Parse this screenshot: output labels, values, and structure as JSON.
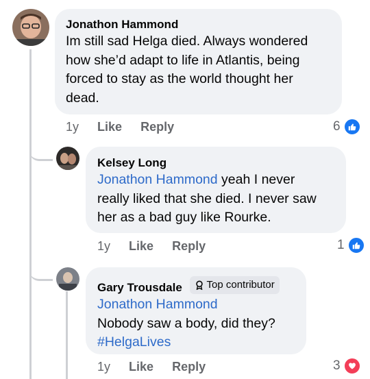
{
  "comments": [
    {
      "author": "Jonathon Hammond",
      "lines": [
        "Im still sad Helga died. Always wondered",
        "how she’d adapt to life in Atlantis, being",
        "forced to stay as the world thought her",
        "dead."
      ],
      "time": "1y",
      "like": "Like",
      "reply": "Reply",
      "reaction_count": "6",
      "reaction_icon": "like-icon",
      "reaction_color": "#1877f2"
    },
    {
      "author": "Kelsey Long",
      "mention": "Jonathon Hammond",
      "lines": [
        " yeah I never",
        "really liked that she died. I never saw",
        "her as a bad guy like Rourke."
      ],
      "time": "1y",
      "like": "Like",
      "reply": "Reply",
      "reaction_count": "1",
      "reaction_icon": "like-icon",
      "reaction_color": "#1877f2"
    },
    {
      "author": "Gary Trousdale",
      "badge": "Top contributor",
      "mention": "Jonathon Hammond",
      "lines": [
        "Nobody saw a body, did they?"
      ],
      "hashtag": "#HelgaLives",
      "time": "1y",
      "like": "Like",
      "reply": "Reply",
      "reaction_count": "3",
      "reaction_icon": "love-icon",
      "reaction_color": "#f33e58"
    }
  ]
}
